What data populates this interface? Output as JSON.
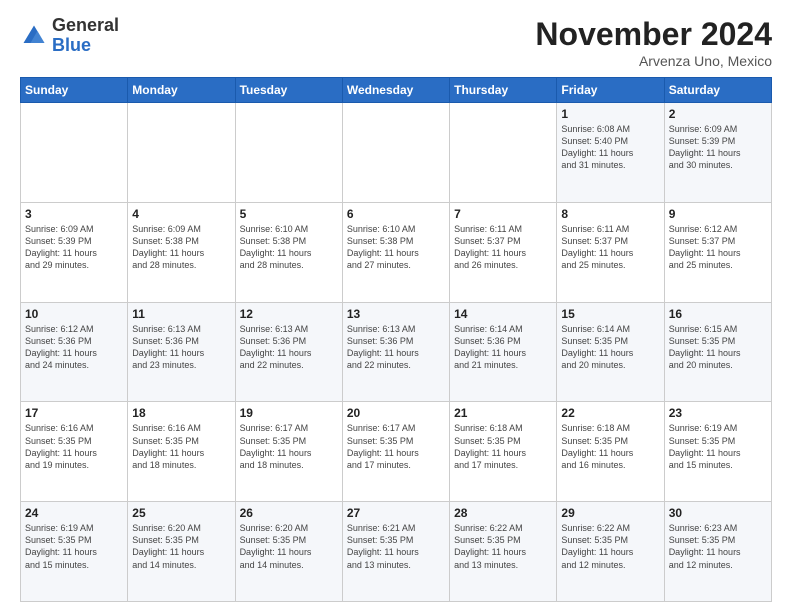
{
  "header": {
    "logo_general": "General",
    "logo_blue": "Blue",
    "month_title": "November 2024",
    "location": "Arvenza Uno, Mexico"
  },
  "days_of_week": [
    "Sunday",
    "Monday",
    "Tuesday",
    "Wednesday",
    "Thursday",
    "Friday",
    "Saturday"
  ],
  "weeks": [
    [
      {
        "day": "",
        "info": ""
      },
      {
        "day": "",
        "info": ""
      },
      {
        "day": "",
        "info": ""
      },
      {
        "day": "",
        "info": ""
      },
      {
        "day": "",
        "info": ""
      },
      {
        "day": "1",
        "info": "Sunrise: 6:08 AM\nSunset: 5:40 PM\nDaylight: 11 hours\nand 31 minutes."
      },
      {
        "day": "2",
        "info": "Sunrise: 6:09 AM\nSunset: 5:39 PM\nDaylight: 11 hours\nand 30 minutes."
      }
    ],
    [
      {
        "day": "3",
        "info": "Sunrise: 6:09 AM\nSunset: 5:39 PM\nDaylight: 11 hours\nand 29 minutes."
      },
      {
        "day": "4",
        "info": "Sunrise: 6:09 AM\nSunset: 5:38 PM\nDaylight: 11 hours\nand 28 minutes."
      },
      {
        "day": "5",
        "info": "Sunrise: 6:10 AM\nSunset: 5:38 PM\nDaylight: 11 hours\nand 28 minutes."
      },
      {
        "day": "6",
        "info": "Sunrise: 6:10 AM\nSunset: 5:38 PM\nDaylight: 11 hours\nand 27 minutes."
      },
      {
        "day": "7",
        "info": "Sunrise: 6:11 AM\nSunset: 5:37 PM\nDaylight: 11 hours\nand 26 minutes."
      },
      {
        "day": "8",
        "info": "Sunrise: 6:11 AM\nSunset: 5:37 PM\nDaylight: 11 hours\nand 25 minutes."
      },
      {
        "day": "9",
        "info": "Sunrise: 6:12 AM\nSunset: 5:37 PM\nDaylight: 11 hours\nand 25 minutes."
      }
    ],
    [
      {
        "day": "10",
        "info": "Sunrise: 6:12 AM\nSunset: 5:36 PM\nDaylight: 11 hours\nand 24 minutes."
      },
      {
        "day": "11",
        "info": "Sunrise: 6:13 AM\nSunset: 5:36 PM\nDaylight: 11 hours\nand 23 minutes."
      },
      {
        "day": "12",
        "info": "Sunrise: 6:13 AM\nSunset: 5:36 PM\nDaylight: 11 hours\nand 22 minutes."
      },
      {
        "day": "13",
        "info": "Sunrise: 6:13 AM\nSunset: 5:36 PM\nDaylight: 11 hours\nand 22 minutes."
      },
      {
        "day": "14",
        "info": "Sunrise: 6:14 AM\nSunset: 5:36 PM\nDaylight: 11 hours\nand 21 minutes."
      },
      {
        "day": "15",
        "info": "Sunrise: 6:14 AM\nSunset: 5:35 PM\nDaylight: 11 hours\nand 20 minutes."
      },
      {
        "day": "16",
        "info": "Sunrise: 6:15 AM\nSunset: 5:35 PM\nDaylight: 11 hours\nand 20 minutes."
      }
    ],
    [
      {
        "day": "17",
        "info": "Sunrise: 6:16 AM\nSunset: 5:35 PM\nDaylight: 11 hours\nand 19 minutes."
      },
      {
        "day": "18",
        "info": "Sunrise: 6:16 AM\nSunset: 5:35 PM\nDaylight: 11 hours\nand 18 minutes."
      },
      {
        "day": "19",
        "info": "Sunrise: 6:17 AM\nSunset: 5:35 PM\nDaylight: 11 hours\nand 18 minutes."
      },
      {
        "day": "20",
        "info": "Sunrise: 6:17 AM\nSunset: 5:35 PM\nDaylight: 11 hours\nand 17 minutes."
      },
      {
        "day": "21",
        "info": "Sunrise: 6:18 AM\nSunset: 5:35 PM\nDaylight: 11 hours\nand 17 minutes."
      },
      {
        "day": "22",
        "info": "Sunrise: 6:18 AM\nSunset: 5:35 PM\nDaylight: 11 hours\nand 16 minutes."
      },
      {
        "day": "23",
        "info": "Sunrise: 6:19 AM\nSunset: 5:35 PM\nDaylight: 11 hours\nand 15 minutes."
      }
    ],
    [
      {
        "day": "24",
        "info": "Sunrise: 6:19 AM\nSunset: 5:35 PM\nDaylight: 11 hours\nand 15 minutes."
      },
      {
        "day": "25",
        "info": "Sunrise: 6:20 AM\nSunset: 5:35 PM\nDaylight: 11 hours\nand 14 minutes."
      },
      {
        "day": "26",
        "info": "Sunrise: 6:20 AM\nSunset: 5:35 PM\nDaylight: 11 hours\nand 14 minutes."
      },
      {
        "day": "27",
        "info": "Sunrise: 6:21 AM\nSunset: 5:35 PM\nDaylight: 11 hours\nand 13 minutes."
      },
      {
        "day": "28",
        "info": "Sunrise: 6:22 AM\nSunset: 5:35 PM\nDaylight: 11 hours\nand 13 minutes."
      },
      {
        "day": "29",
        "info": "Sunrise: 6:22 AM\nSunset: 5:35 PM\nDaylight: 11 hours\nand 12 minutes."
      },
      {
        "day": "30",
        "info": "Sunrise: 6:23 AM\nSunset: 5:35 PM\nDaylight: 11 hours\nand 12 minutes."
      }
    ]
  ]
}
